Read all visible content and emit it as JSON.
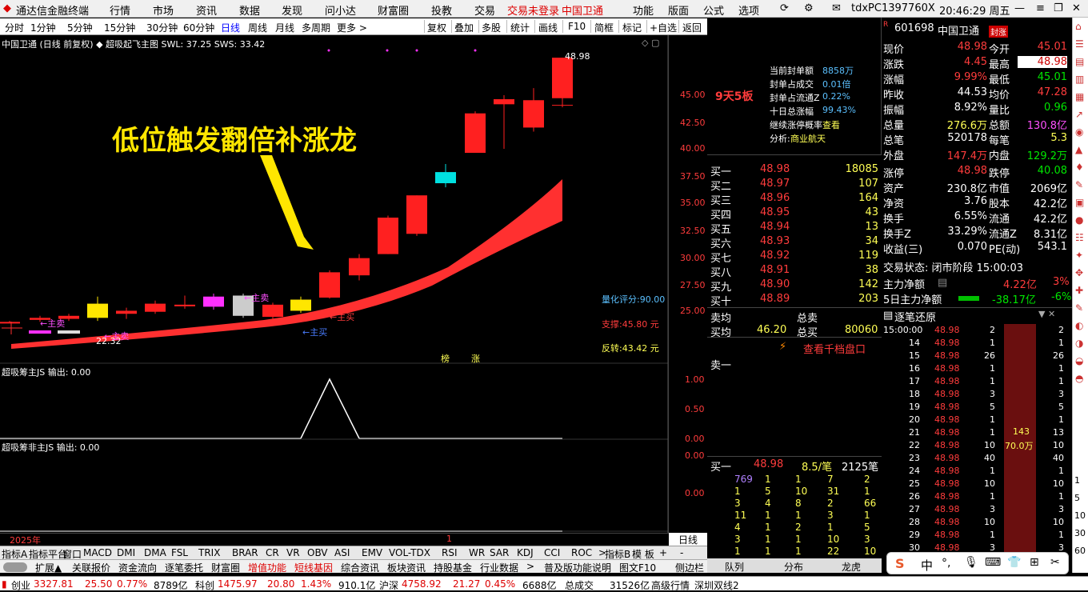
{
  "app": {
    "title": "通达信金融终端",
    "menus": [
      "行情",
      "市场",
      "资讯",
      "数据",
      "发现",
      "问小达",
      "财富圈",
      "投教",
      "交易"
    ],
    "trade_login": "交易未登录",
    "stock_tag": "中国卫通",
    "right_menus": [
      "功能",
      "版面",
      "公式",
      "选项"
    ],
    "account": "tdxPC1397760X",
    "clock": "20:46:29 周五"
  },
  "chartbar": {
    "periods": [
      "分时",
      "1分钟",
      "5分钟",
      "15分钟",
      "30分钟",
      "60分钟",
      "日线",
      "周线",
      "月线",
      "多周期",
      "更多 >"
    ],
    "active": "日线",
    "tools": [
      "复权",
      "叠加",
      "多股",
      "统计",
      "画线",
      "F10",
      "简框",
      "标记",
      "+自选",
      "返回"
    ]
  },
  "chart": {
    "header": "中国卫通 (日线 前复权) ◆ 超吸起飞主图 SWL: 37.25 SWS: 33.42",
    "annotation": "低位触发翻倍补涨龙",
    "high_label": "48.98",
    "low_label": "22.32",
    "score": "量化评分:90.00",
    "support": "支撑:45.80 元",
    "reversal": "反转:43.42 元",
    "main_sell": "←主卖",
    "main_sell2": "←主卖",
    "main_sell3": "←主卖",
    "main_buy": "←主买",
    "main_buy2": "←主买",
    "mark1": "榜",
    "mark2": "涨",
    "year_label": "2025年",
    "cursor_label": "1",
    "period_label": "日线"
  },
  "sub1": {
    "header": "超吸筹主JS  输出: 0.00",
    "ticks": [
      "1.00",
      "0.50",
      "0.00"
    ]
  },
  "sub2": {
    "header": "超吸筹非主JS  输出: 0.00",
    "ticks": [
      "0.00",
      "0.00"
    ]
  },
  "price_axis": [
    "45.00",
    "42.50",
    "40.00",
    "37.50",
    "35.00",
    "32.50",
    "30.00",
    "27.50",
    "25.00"
  ],
  "chart_data": {
    "type": "candlestick",
    "candles": [
      {
        "o": 22.9,
        "c": 22.9,
        "h": 23.0,
        "l": 22.8
      },
      {
        "o": 23.1,
        "c": 23.3,
        "h": 23.5,
        "l": 22.9
      },
      {
        "o": 23.2,
        "c": 23.5,
        "h": 23.7,
        "l": 23.0
      },
      {
        "o": 23.3,
        "c": 24.7,
        "h": 25.4,
        "l": 23.0
      },
      {
        "o": 23.7,
        "c": 24.0,
        "h": 24.3,
        "l": 23.2
      },
      {
        "o": 23.9,
        "c": 24.7,
        "h": 25.0,
        "l": 23.7
      },
      {
        "o": 24.5,
        "c": 24.6,
        "h": 25.5,
        "l": 24.2
      },
      {
        "o": 24.4,
        "c": 25.4,
        "h": 25.7,
        "l": 24.1
      },
      {
        "o": 25.5,
        "c": 23.5,
        "h": 25.7,
        "l": 23.3
      },
      {
        "o": 23.4,
        "c": 24.6,
        "h": 24.8,
        "l": 23.2
      },
      {
        "o": 24.0,
        "c": 25.1,
        "h": 25.4,
        "l": 23.8
      },
      {
        "o": 25.3,
        "c": 27.8,
        "h": 28.0,
        "l": 25.2
      },
      {
        "o": 27.5,
        "c": 29.2,
        "h": 29.6,
        "l": 27.0
      },
      {
        "o": 29.6,
        "c": 33.2,
        "h": 33.4,
        "l": 29.6
      },
      {
        "o": 31.6,
        "c": 35.4,
        "h": 35.4,
        "l": 31.4
      },
      {
        "o": 37.7,
        "c": 36.6,
        "h": 38.5,
        "l": 36.2
      },
      {
        "o": 39.6,
        "c": 43.5,
        "h": 43.7,
        "l": 39.6
      },
      {
        "o": 44.4,
        "c": 44.9,
        "h": 45.3,
        "l": 40.0
      },
      {
        "o": 42.1,
        "c": 44.8,
        "h": 46.0,
        "l": 41.7
      },
      {
        "o": 45.0,
        "c": 49.0,
        "h": 49.0,
        "l": 44.1
      }
    ],
    "ylim": [
      20.4,
      49.8
    ]
  },
  "quote": {
    "code": "601698",
    "name": "中国卫通",
    "tag": "封涨",
    "rows": [
      [
        "现价",
        "48.98",
        "今开",
        "45.01"
      ],
      [
        "涨跌",
        "4.45",
        "最高",
        "48.98"
      ],
      [
        "涨幅",
        "9.99%",
        "最低",
        "45.01"
      ],
      [
        "昨收",
        "44.53",
        "均价",
        "47.28"
      ],
      [
        "振幅",
        "8.92%",
        "量比",
        "0.96"
      ],
      [
        "总量",
        "276.6万",
        "总额",
        "130.8亿"
      ],
      [
        "总笔",
        "520178",
        "每笔",
        "5.3"
      ],
      [
        "外盘",
        "147.4万",
        "内盘",
        "129.2万"
      ]
    ],
    "rows2": [
      [
        "涨停",
        "48.98",
        "跌停",
        "40.08"
      ],
      [
        "资产",
        "230.8亿",
        "市值",
        "2069亿"
      ],
      [
        "净资",
        "3.76",
        "股本",
        "42.2亿"
      ],
      [
        "换手",
        "6.55%",
        "流通",
        "42.2亿"
      ],
      [
        "换手Z",
        "33.29%",
        "流通Z",
        "8.31亿"
      ],
      [
        "收益(三)",
        "0.070",
        "PE(动)",
        "543.1"
      ]
    ],
    "trade_state": "交易状态: 闭市阶段 15:00:03",
    "main_net": [
      "主力净额",
      "4.22亿",
      "3%"
    ],
    "main_net5": [
      "5日主力净额",
      "-38.17亿",
      "-6%"
    ]
  },
  "limit": {
    "board": "9天5板",
    "rows": [
      [
        "当前封单额",
        "8858万"
      ],
      [
        "封单占成交",
        "0.01倍"
      ],
      [
        "封单占流通Z",
        "0.22%"
      ],
      [
        "十日总涨幅",
        "99.43%"
      ],
      [
        "继续涨停概率",
        "查看"
      ],
      [
        "分析:",
        "商业航天"
      ]
    ]
  },
  "orderbook": {
    "bids": [
      [
        "买一",
        "48.98",
        "18085"
      ],
      [
        "买二",
        "48.97",
        "107"
      ],
      [
        "买三",
        "48.96",
        "164"
      ],
      [
        "买四",
        "48.95",
        "43"
      ],
      [
        "买五",
        "48.94",
        "13"
      ],
      [
        "买六",
        "48.93",
        "34"
      ],
      [
        "买七",
        "48.92",
        "119"
      ],
      [
        "买八",
        "48.91",
        "38"
      ],
      [
        "买九",
        "48.90",
        "142"
      ],
      [
        "买十",
        "48.89",
        "203"
      ]
    ],
    "avg": [
      "卖均",
      "总卖",
      "买均",
      "46.20",
      "总买",
      "80060"
    ],
    "view_all": "查看千档盘口",
    "sell1": "卖一",
    "queue_head": [
      "买一",
      "48.98",
      "8.5/笔",
      "2125笔"
    ],
    "queue": [
      [
        "769",
        "1",
        "1",
        "7",
        "2"
      ],
      [
        "1",
        "5",
        "10",
        "31",
        "1"
      ],
      [
        "3",
        "4",
        "8",
        "2",
        "66"
      ],
      [
        "11",
        "1",
        "1",
        "3",
        "1"
      ],
      [
        "4",
        "1",
        "2",
        "1",
        "5"
      ],
      [
        "3",
        "1",
        "1",
        "10",
        "3"
      ],
      [
        "1",
        "1",
        "1",
        "22",
        "10"
      ]
    ],
    "tabs": [
      "队列",
      "分布",
      "龙虎"
    ]
  },
  "ticks": {
    "title": "逐笔还原",
    "rows": [
      [
        "15:00:00",
        "48.98",
        "2"
      ],
      [
        "14",
        "48.98",
        "1"
      ],
      [
        "15",
        "48.98",
        "26"
      ],
      [
        "16",
        "48.98",
        "1"
      ],
      [
        "17",
        "48.98",
        "1"
      ],
      [
        "18",
        "48.98",
        "3"
      ],
      [
        "19",
        "48.98",
        "5"
      ],
      [
        "20",
        "48.98",
        "1"
      ],
      [
        "21",
        "48.98",
        "1"
      ],
      [
        "22",
        "48.98",
        "10"
      ],
      [
        "23",
        "48.98",
        "40"
      ],
      [
        "24",
        "48.98",
        "1"
      ],
      [
        "25",
        "48.98",
        "10"
      ],
      [
        "26",
        "48.98",
        "1"
      ],
      [
        "27",
        "48.98",
        "3"
      ],
      [
        "28",
        "48.98",
        "10"
      ],
      [
        "29",
        "48.98",
        "1"
      ],
      [
        "30",
        "48.98",
        "3"
      ]
    ],
    "right": [
      "2",
      "1",
      "26",
      "1",
      "1",
      "3",
      "5",
      "1",
      "13",
      "10",
      "40",
      "1",
      "10",
      "1",
      "3",
      "10",
      "1",
      "3"
    ],
    "bar_num": "143",
    "bar_val": "70.0万",
    "scale": [
      "1",
      "5",
      "10",
      "30",
      "60"
    ]
  },
  "indicators": [
    "指标A",
    "指标平台",
    "窗口",
    "MACD",
    "DMI",
    "DMA",
    "FSL",
    "TRIX",
    "BRAR",
    "CR",
    "VR",
    "OBV",
    "ASI",
    "EMV",
    "VOL-TDX",
    "RSI",
    "WR",
    "SAR",
    "KDJ",
    "CCI",
    "ROC",
    ">",
    "指标B",
    "模 板",
    "+",
    "-"
  ],
  "navtabs": [
    "扩展▲",
    "关联报价",
    "资金流向",
    "逐笔委托",
    "财富圈",
    "增值功能",
    "短线基因",
    "综合资讯",
    "板块资讯",
    "持股基金",
    "行业数据",
    ">",
    "普及版功能说明",
    "图文F10",
    "侧边栏 《"
  ],
  "status": {
    "items": [
      [
        "创业",
        "3327.81",
        "25.50",
        "0.77%",
        "8789亿"
      ],
      [
        "科创",
        "1475.97",
        "20.80",
        "1.43%",
        "910.1亿"
      ],
      [
        "沪深",
        "4758.92",
        "21.27",
        "0.45%",
        "6688亿"
      ]
    ],
    "total_label": "总成交",
    "total": "31526亿",
    "feed": "高级行情_深圳双线2"
  },
  "ime": [
    "S",
    "中",
    "°,",
    "🎙",
    "⌨",
    "👕",
    "⊞",
    "✂"
  ]
}
